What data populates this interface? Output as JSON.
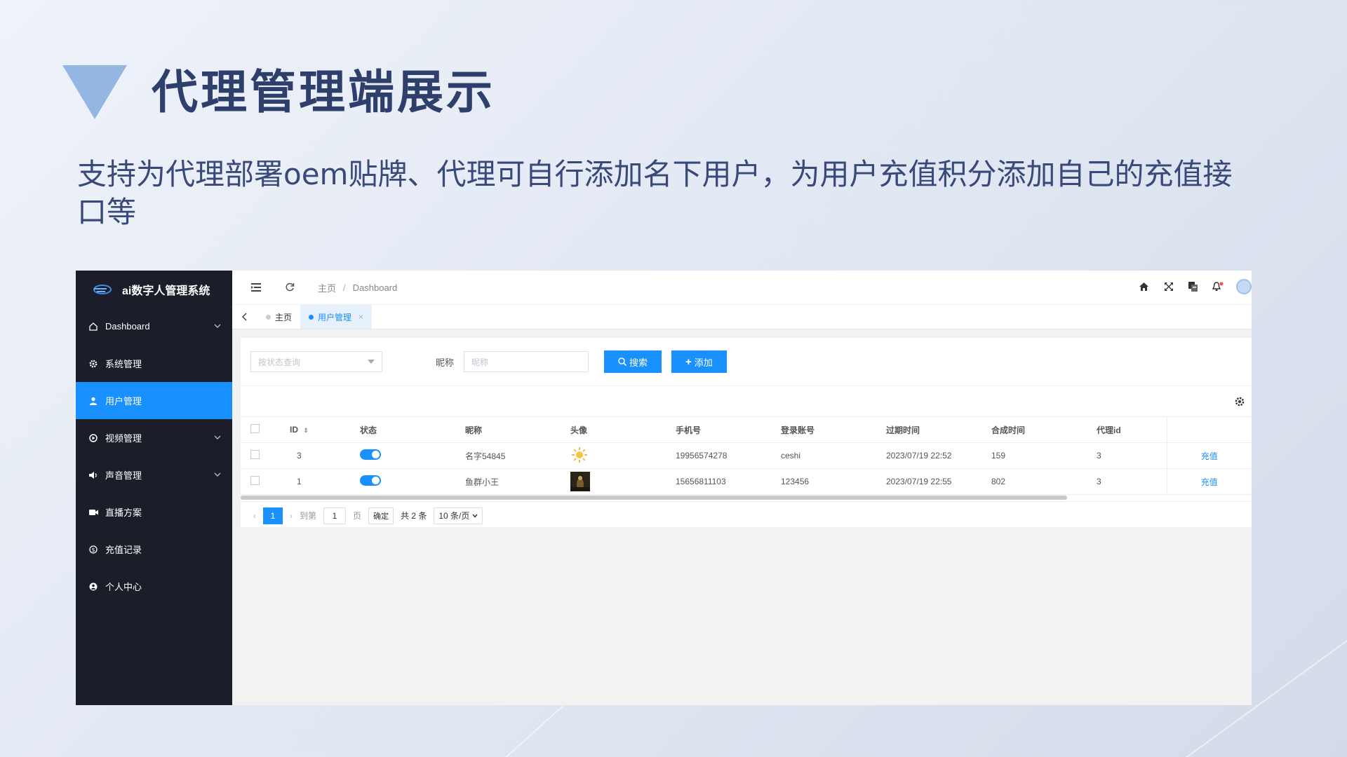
{
  "slide": {
    "title": "代理管理端展示",
    "subtitle": "支持为代理部署oem贴牌、代理可自行添加名下用户，为用户充值积分添加自己的充值接口等"
  },
  "app": {
    "brand_name": "ai数字人管理系统",
    "sidebar": {
      "items": [
        {
          "label": "Dashboard",
          "icon": "home-icon",
          "has_children": true,
          "active": false
        },
        {
          "label": "系统管理",
          "icon": "gear-icon",
          "has_children": false,
          "active": false
        },
        {
          "label": "用户管理",
          "icon": "user-icon",
          "has_children": false,
          "active": true
        },
        {
          "label": "视频管理",
          "icon": "play-icon",
          "has_children": true,
          "active": false
        },
        {
          "label": "声音管理",
          "icon": "speaker-icon",
          "has_children": true,
          "active": false
        },
        {
          "label": "直播方案",
          "icon": "video-camera-icon",
          "has_children": false,
          "active": false
        },
        {
          "label": "充值记录",
          "icon": "dollar-icon",
          "has_children": false,
          "active": false
        },
        {
          "label": "个人中心",
          "icon": "user-circle-icon",
          "has_children": false,
          "active": false
        }
      ]
    },
    "breadcrumb": {
      "home": "主页",
      "separator": "/",
      "current": "Dashboard"
    },
    "tabs": [
      {
        "label": "主页",
        "active": false
      },
      {
        "label": "用户管理",
        "active": true,
        "close": "×"
      }
    ],
    "filters": {
      "status_placeholder": "按状态查询",
      "nickname_label": "昵称",
      "nickname_placeholder": "昵称",
      "search_label": "搜索",
      "add_label": "添加"
    },
    "table": {
      "columns": [
        "ID",
        "状态",
        "昵称",
        "头像",
        "手机号",
        "登录账号",
        "过期时间",
        "合成时间",
        "代理id"
      ],
      "rows": [
        {
          "id": "3",
          "enabled": true,
          "nickname": "名字54845",
          "avatar": "sun-avatar",
          "phone": "19956574278",
          "account": "ceshi",
          "expire": "2023/07/19 22:52",
          "synth": "159",
          "agent_id": "3",
          "action": "充值"
        },
        {
          "id": "1",
          "enabled": true,
          "nickname": "鱼群小王",
          "avatar": "dark-photo-avatar",
          "phone": "15656811103",
          "account": "123456",
          "expire": "2023/07/19 22:55",
          "synth": "802",
          "agent_id": "3",
          "action": "充值"
        }
      ]
    },
    "pagination": {
      "current_page": "1",
      "goto_label": "到第",
      "goto_value": "1",
      "page_label": "页",
      "confirm_label": "确定",
      "total_label": "共 2 条",
      "page_size": "10 条/页"
    }
  },
  "colors": {
    "accent": "#1890ff",
    "sidebar_bg": "#1b1d29",
    "title": "#2e3f6b",
    "triangle": "#94b6e2"
  }
}
